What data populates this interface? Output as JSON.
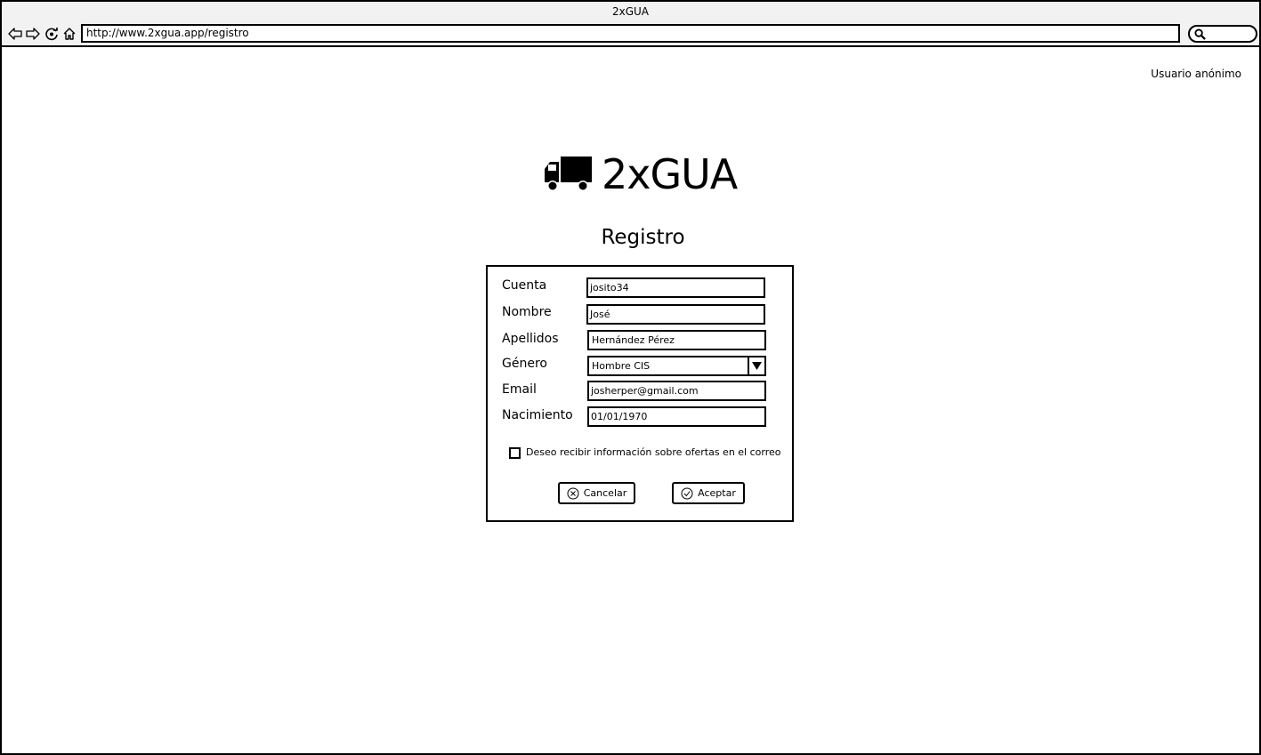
{
  "browser": {
    "title": "2xGUA",
    "url": "http://www.2xgua.app/registro"
  },
  "header": {
    "user_label": "Usuario anónimo"
  },
  "logo": {
    "text": "2xGUA",
    "icon": "truck-icon"
  },
  "form": {
    "title": "Registro",
    "fields": {
      "cuenta": {
        "label": "Cuenta",
        "value": "josito34"
      },
      "nombre": {
        "label": "Nombre",
        "value": "José"
      },
      "apellidos": {
        "label": "Apellidos",
        "value": "Hernández Pérez"
      },
      "genero": {
        "label": "Género",
        "value": "Hombre CIS"
      },
      "email": {
        "label": "Email",
        "value": "josherper@gmail.com"
      },
      "nacimiento": {
        "label": "Nacimiento",
        "value": "01/01/1970"
      }
    },
    "newsletter": {
      "label": "Deseo recibir información sobre ofertas en el correo",
      "checked": false
    },
    "cancel_label": "Cancelar",
    "accept_label": "Aceptar"
  }
}
